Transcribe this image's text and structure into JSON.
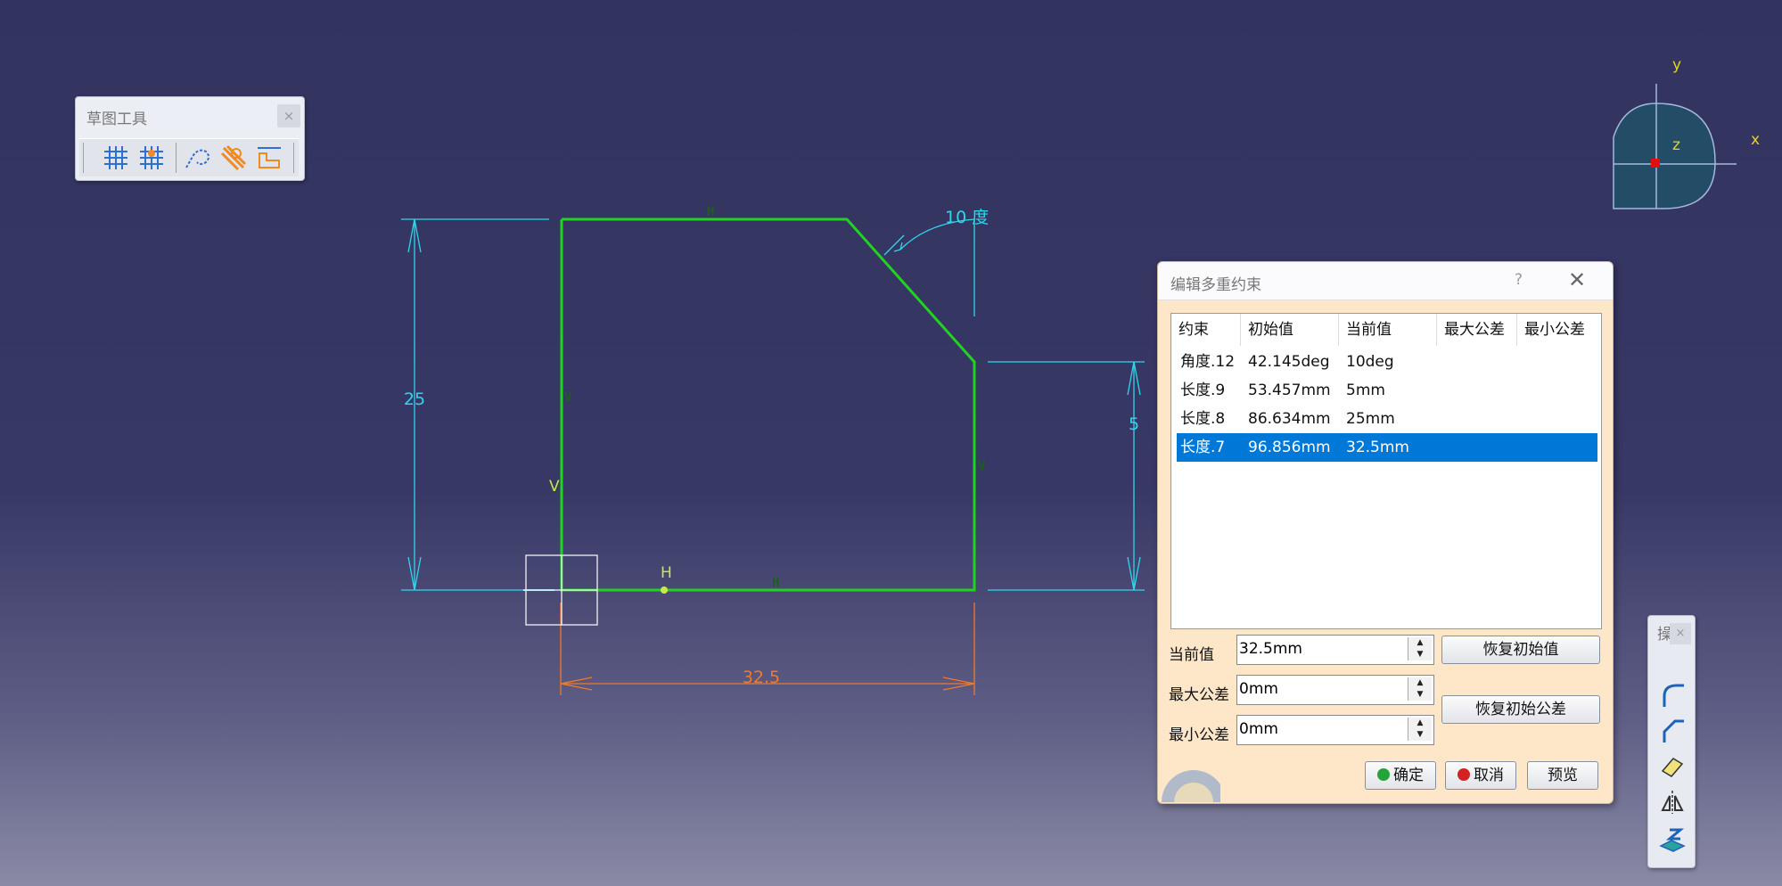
{
  "toolbar": {
    "title": "草图工具",
    "close": "×",
    "buttons": [
      "grid-icon",
      "snap-to-point-icon",
      "construction-element-icon",
      "geometric-constraints-icon",
      "dimensional-constraints-icon"
    ]
  },
  "sketch": {
    "dim_height": "25",
    "dim_right": "5",
    "dim_width": "32.5",
    "dim_angle": "10 度",
    "constraint_h": "H",
    "constraint_v": "V",
    "axis_x": "x",
    "axis_y": "y",
    "axis_z": "z"
  },
  "dialog": {
    "title": "编辑多重约束",
    "help": "?",
    "close": "✕",
    "columns": [
      "约束",
      "初始值",
      "当前值",
      "最大公差",
      "最小公差"
    ],
    "rows": [
      {
        "name": "角度.12",
        "initial": "42.145deg",
        "current": "10deg",
        "max": "",
        "min": ""
      },
      {
        "name": "长度.9",
        "initial": "53.457mm",
        "current": "5mm",
        "max": "",
        "min": ""
      },
      {
        "name": "长度.8",
        "initial": "86.634mm",
        "current": "25mm",
        "max": "",
        "min": ""
      },
      {
        "name": "长度.7",
        "initial": "96.856mm",
        "current": "32.5mm",
        "max": "",
        "min": ""
      }
    ],
    "selected_row": 3,
    "current_label": "当前值",
    "current_value": "32.5mm",
    "max_tol_label": "最大公差",
    "max_tol_value": "0mm",
    "min_tol_label": "最小公差",
    "min_tol_value": "0mm",
    "restore_value_btn": "恢复初始值",
    "restore_tol_btn": "恢复初始公差",
    "ok_btn": "确定",
    "cancel_btn": "取消",
    "preview_btn": "预览"
  },
  "sidebar": {
    "title": "操",
    "close": "×",
    "buttons": [
      "corner-icon",
      "chamfer-icon",
      "trim-icon",
      "mirror-icon",
      "project-3d-icon"
    ]
  },
  "colors": {
    "geometry": "#21d321",
    "dimension": "#2fd6ea",
    "driving_dimension": "#f07a2a",
    "selection": "#0078d7",
    "constraint_symbol": "#1d5e1d",
    "background": "#383866"
  }
}
